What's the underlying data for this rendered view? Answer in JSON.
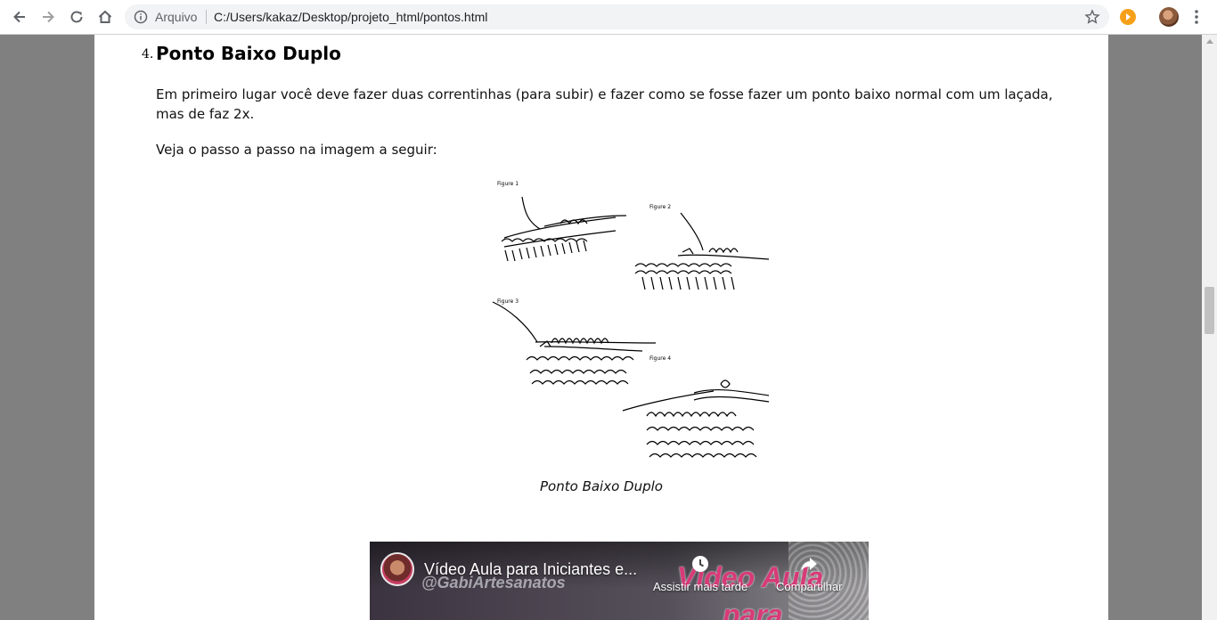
{
  "browser": {
    "address_prefix": "Arquivo",
    "url": "C:/Users/kakaz/Desktop/projeto_html/pontos.html"
  },
  "article": {
    "list_number": "4.",
    "heading": "Ponto Baixo Duplo",
    "paragraph1": "Em primeiro lugar você deve fazer duas correntinhas (para subir) e fazer como se fosse fazer um ponto baixo normal com um laçada, mas de faz 2x.",
    "paragraph2": "Veja o passo a passo na imagem a seguir:",
    "figure_labels": [
      "Figure 1",
      "Figure 2",
      "Figure 3",
      "Figure 4"
    ],
    "caption": "Ponto Baixo Duplo"
  },
  "video": {
    "title": "Vídeo Aula para Iniciantes e...",
    "watermark": "@GabiArtesanatos",
    "overlay_line1": "Vídeo Aula",
    "overlay_line2": "para",
    "watch_later": "Assistir mais tarde",
    "share": "Compartilhar"
  }
}
